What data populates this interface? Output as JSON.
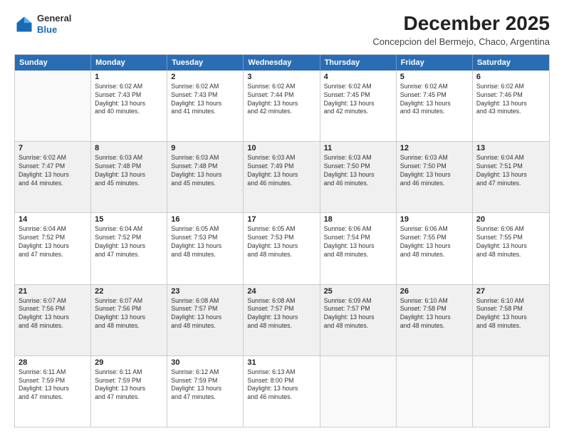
{
  "logo": {
    "general": "General",
    "blue": "Blue"
  },
  "title": {
    "month_year": "December 2025",
    "location": "Concepcion del Bermejo, Chaco, Argentina"
  },
  "header_days": [
    "Sunday",
    "Monday",
    "Tuesday",
    "Wednesday",
    "Thursday",
    "Friday",
    "Saturday"
  ],
  "rows": [
    [
      {
        "day": "",
        "lines": [],
        "empty": true
      },
      {
        "day": "1",
        "lines": [
          "Sunrise: 6:02 AM",
          "Sunset: 7:43 PM",
          "Daylight: 13 hours",
          "and 40 minutes."
        ]
      },
      {
        "day": "2",
        "lines": [
          "Sunrise: 6:02 AM",
          "Sunset: 7:43 PM",
          "Daylight: 13 hours",
          "and 41 minutes."
        ]
      },
      {
        "day": "3",
        "lines": [
          "Sunrise: 6:02 AM",
          "Sunset: 7:44 PM",
          "Daylight: 13 hours",
          "and 42 minutes."
        ]
      },
      {
        "day": "4",
        "lines": [
          "Sunrise: 6:02 AM",
          "Sunset: 7:45 PM",
          "Daylight: 13 hours",
          "and 42 minutes."
        ]
      },
      {
        "day": "5",
        "lines": [
          "Sunrise: 6:02 AM",
          "Sunset: 7:45 PM",
          "Daylight: 13 hours",
          "and 43 minutes."
        ]
      },
      {
        "day": "6",
        "lines": [
          "Sunrise: 6:02 AM",
          "Sunset: 7:46 PM",
          "Daylight: 13 hours",
          "and 43 minutes."
        ]
      }
    ],
    [
      {
        "day": "7",
        "lines": [
          "Sunrise: 6:02 AM",
          "Sunset: 7:47 PM",
          "Daylight: 13 hours",
          "and 44 minutes."
        ],
        "shaded": true
      },
      {
        "day": "8",
        "lines": [
          "Sunrise: 6:03 AM",
          "Sunset: 7:48 PM",
          "Daylight: 13 hours",
          "and 45 minutes."
        ],
        "shaded": true
      },
      {
        "day": "9",
        "lines": [
          "Sunrise: 6:03 AM",
          "Sunset: 7:48 PM",
          "Daylight: 13 hours",
          "and 45 minutes."
        ],
        "shaded": true
      },
      {
        "day": "10",
        "lines": [
          "Sunrise: 6:03 AM",
          "Sunset: 7:49 PM",
          "Daylight: 13 hours",
          "and 46 minutes."
        ],
        "shaded": true
      },
      {
        "day": "11",
        "lines": [
          "Sunrise: 6:03 AM",
          "Sunset: 7:50 PM",
          "Daylight: 13 hours",
          "and 46 minutes."
        ],
        "shaded": true
      },
      {
        "day": "12",
        "lines": [
          "Sunrise: 6:03 AM",
          "Sunset: 7:50 PM",
          "Daylight: 13 hours",
          "and 46 minutes."
        ],
        "shaded": true
      },
      {
        "day": "13",
        "lines": [
          "Sunrise: 6:04 AM",
          "Sunset: 7:51 PM",
          "Daylight: 13 hours",
          "and 47 minutes."
        ],
        "shaded": true
      }
    ],
    [
      {
        "day": "14",
        "lines": [
          "Sunrise: 6:04 AM",
          "Sunset: 7:52 PM",
          "Daylight: 13 hours",
          "and 47 minutes."
        ]
      },
      {
        "day": "15",
        "lines": [
          "Sunrise: 6:04 AM",
          "Sunset: 7:52 PM",
          "Daylight: 13 hours",
          "and 47 minutes."
        ]
      },
      {
        "day": "16",
        "lines": [
          "Sunrise: 6:05 AM",
          "Sunset: 7:53 PM",
          "Daylight: 13 hours",
          "and 48 minutes."
        ]
      },
      {
        "day": "17",
        "lines": [
          "Sunrise: 6:05 AM",
          "Sunset: 7:53 PM",
          "Daylight: 13 hours",
          "and 48 minutes."
        ]
      },
      {
        "day": "18",
        "lines": [
          "Sunrise: 6:06 AM",
          "Sunset: 7:54 PM",
          "Daylight: 13 hours",
          "and 48 minutes."
        ]
      },
      {
        "day": "19",
        "lines": [
          "Sunrise: 6:06 AM",
          "Sunset: 7:55 PM",
          "Daylight: 13 hours",
          "and 48 minutes."
        ]
      },
      {
        "day": "20",
        "lines": [
          "Sunrise: 6:06 AM",
          "Sunset: 7:55 PM",
          "Daylight: 13 hours",
          "and 48 minutes."
        ]
      }
    ],
    [
      {
        "day": "21",
        "lines": [
          "Sunrise: 6:07 AM",
          "Sunset: 7:56 PM",
          "Daylight: 13 hours",
          "and 48 minutes."
        ],
        "shaded": true
      },
      {
        "day": "22",
        "lines": [
          "Sunrise: 6:07 AM",
          "Sunset: 7:56 PM",
          "Daylight: 13 hours",
          "and 48 minutes."
        ],
        "shaded": true
      },
      {
        "day": "23",
        "lines": [
          "Sunrise: 6:08 AM",
          "Sunset: 7:57 PM",
          "Daylight: 13 hours",
          "and 48 minutes."
        ],
        "shaded": true
      },
      {
        "day": "24",
        "lines": [
          "Sunrise: 6:08 AM",
          "Sunset: 7:57 PM",
          "Daylight: 13 hours",
          "and 48 minutes."
        ],
        "shaded": true
      },
      {
        "day": "25",
        "lines": [
          "Sunrise: 6:09 AM",
          "Sunset: 7:57 PM",
          "Daylight: 13 hours",
          "and 48 minutes."
        ],
        "shaded": true
      },
      {
        "day": "26",
        "lines": [
          "Sunrise: 6:10 AM",
          "Sunset: 7:58 PM",
          "Daylight: 13 hours",
          "and 48 minutes."
        ],
        "shaded": true
      },
      {
        "day": "27",
        "lines": [
          "Sunrise: 6:10 AM",
          "Sunset: 7:58 PM",
          "Daylight: 13 hours",
          "and 48 minutes."
        ],
        "shaded": true
      }
    ],
    [
      {
        "day": "28",
        "lines": [
          "Sunrise: 6:11 AM",
          "Sunset: 7:59 PM",
          "Daylight: 13 hours",
          "and 47 minutes."
        ]
      },
      {
        "day": "29",
        "lines": [
          "Sunrise: 6:11 AM",
          "Sunset: 7:59 PM",
          "Daylight: 13 hours",
          "and 47 minutes."
        ]
      },
      {
        "day": "30",
        "lines": [
          "Sunrise: 6:12 AM",
          "Sunset: 7:59 PM",
          "Daylight: 13 hours",
          "and 47 minutes."
        ]
      },
      {
        "day": "31",
        "lines": [
          "Sunrise: 6:13 AM",
          "Sunset: 8:00 PM",
          "Daylight: 13 hours",
          "and 46 minutes."
        ]
      },
      {
        "day": "",
        "lines": [],
        "empty": true
      },
      {
        "day": "",
        "lines": [],
        "empty": true
      },
      {
        "day": "",
        "lines": [],
        "empty": true
      }
    ]
  ]
}
